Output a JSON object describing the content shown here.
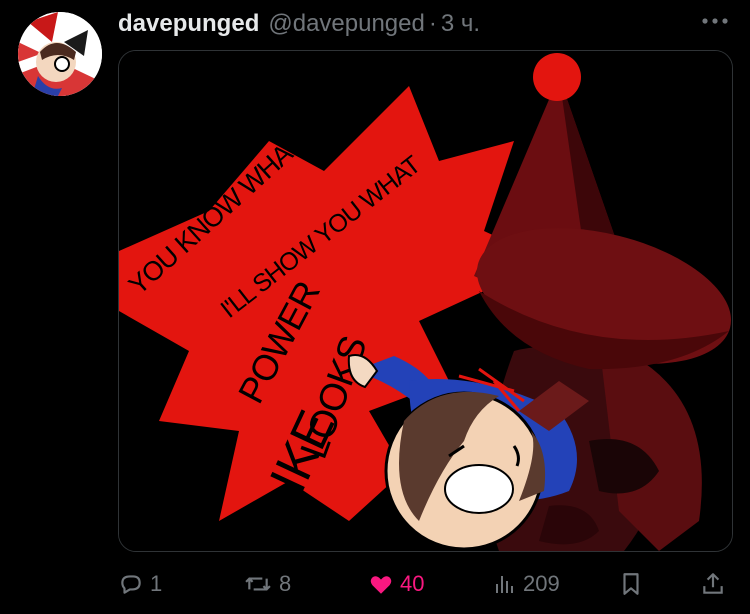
{
  "tweet": {
    "display_name": "davepunged",
    "handle": "@davepunged",
    "separator": "·",
    "time": "3 ч."
  },
  "media": {
    "lettering": [
      "YOU KNOW WHAT POWER FEELS LIKE",
      "I'LL SHOW YOU WHAT",
      "POWER",
      "LOOKS",
      "LIKE"
    ]
  },
  "actions": {
    "replies": "1",
    "reposts": "8",
    "likes": "40",
    "views": "209"
  },
  "colors": {
    "background": "#000000",
    "secondary_text": "#71767b",
    "like_pink": "#f91880",
    "art_red": "#e3150f",
    "hat_red": "#7a0f12"
  },
  "icons": [
    "more-icon",
    "reply-icon",
    "repost-icon",
    "heart-icon",
    "views-icon",
    "bookmark-icon",
    "share-icon"
  ]
}
